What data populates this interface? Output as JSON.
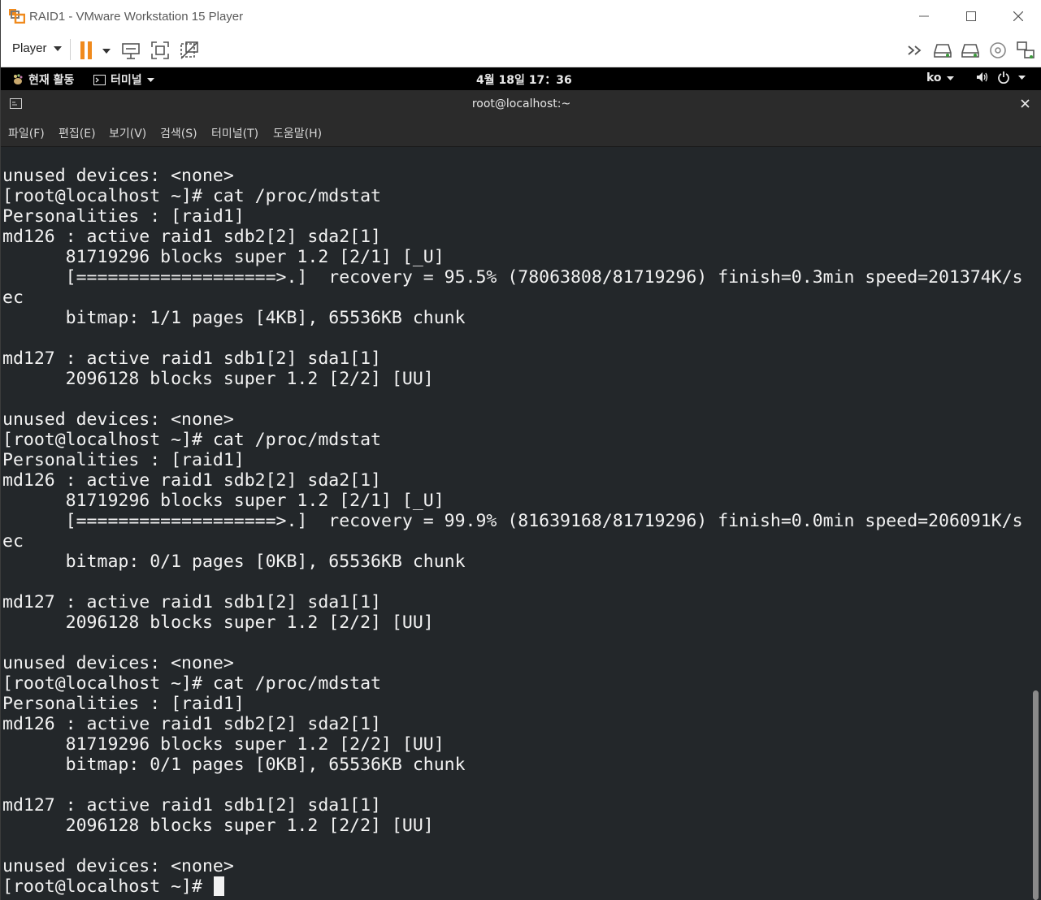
{
  "window": {
    "title": "RAID1 - VMware Workstation 15 Player",
    "controls": [
      "minimize-icon",
      "maximize-icon",
      "close-icon"
    ]
  },
  "toolbar": {
    "player_label": "Player",
    "icons": [
      "pause-icon",
      "send-ctrl-alt-del-icon",
      "fullscreen-icon",
      "unity-icon"
    ],
    "right_icons": [
      "more-icon",
      "hard-disk-icon",
      "hard-disk-2-icon",
      "cd-dvd-icon",
      "network-icon"
    ],
    "accent": "#f08a1d"
  },
  "gnome": {
    "activities": "현재 활동",
    "app_menu": "터미널",
    "clock": "4월 18일  17：36",
    "lang": "ko"
  },
  "terminal": {
    "title": "root@localhost:~",
    "menu": [
      "파일(F)",
      "편집(E)",
      "보기(V)",
      "검색(S)",
      "터미널(T)",
      "도움말(H)"
    ],
    "lines": [
      "unused devices: <none>",
      "[root@localhost ~]# cat /proc/mdstat",
      "Personalities : [raid1]",
      "md126 : active raid1 sdb2[2] sda2[1]",
      "      81719296 blocks super 1.2 [2/1] [_U]",
      "      [===================>.]  recovery = 95.5% (78063808/81719296) finish=0.3min speed=201374K/s",
      "ec",
      "      bitmap: 1/1 pages [4KB], 65536KB chunk",
      "",
      "md127 : active raid1 sdb1[2] sda1[1]",
      "      2096128 blocks super 1.2 [2/2] [UU]",
      "",
      "unused devices: <none>",
      "[root@localhost ~]# cat /proc/mdstat",
      "Personalities : [raid1]",
      "md126 : active raid1 sdb2[2] sda2[1]",
      "      81719296 blocks super 1.2 [2/1] [_U]",
      "      [===================>.]  recovery = 99.9% (81639168/81719296) finish=0.0min speed=206091K/s",
      "ec",
      "      bitmap: 0/1 pages [0KB], 65536KB chunk",
      "",
      "md127 : active raid1 sdb1[2] sda1[1]",
      "      2096128 blocks super 1.2 [2/2] [UU]",
      "",
      "unused devices: <none>",
      "[root@localhost ~]# cat /proc/mdstat",
      "Personalities : [raid1]",
      "md126 : active raid1 sdb2[2] sda2[1]",
      "      81719296 blocks super 1.2 [2/2] [UU]",
      "      bitmap: 0/1 pages [0KB], 65536KB chunk",
      "",
      "md127 : active raid1 sdb1[2] sda1[1]",
      "      2096128 blocks super 1.2 [2/2] [UU]",
      "",
      "unused devices: <none>",
      "[root@localhost ~]# "
    ]
  }
}
